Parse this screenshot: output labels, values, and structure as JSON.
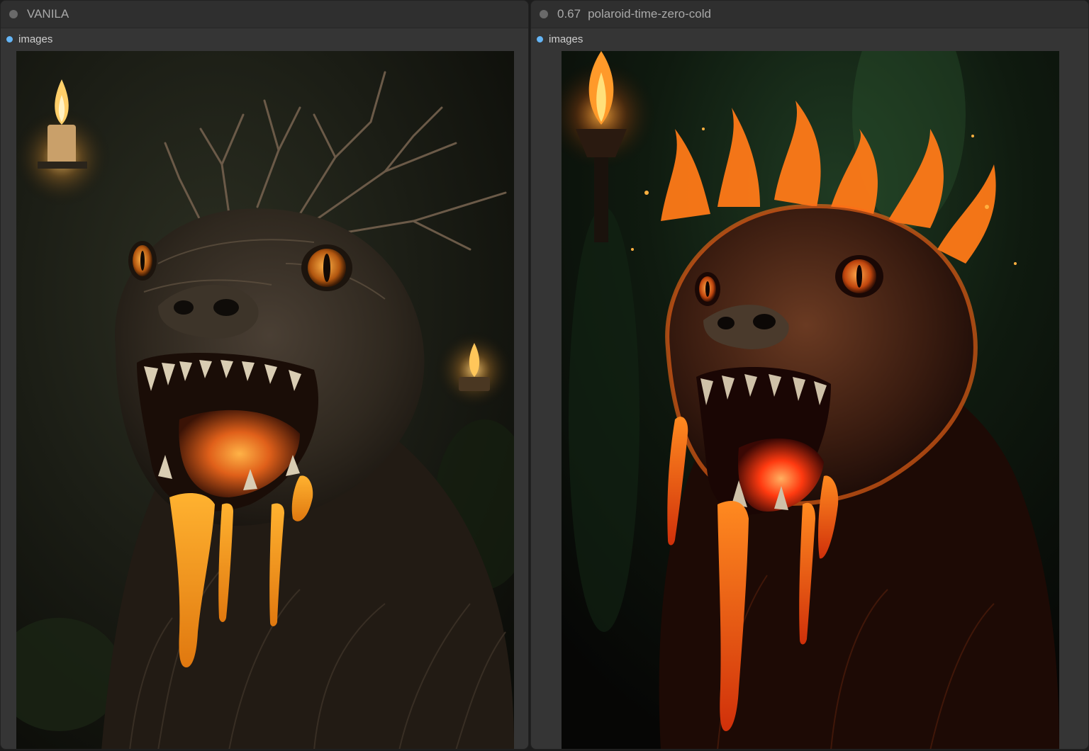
{
  "nodes": [
    {
      "title": "VANILA",
      "strength": "",
      "output_slot": "images",
      "image": {
        "subject": "dark wooden root creature with candles and dripping honey-like glow"
      }
    },
    {
      "title": "polaroid-time-zero-cold",
      "strength": "0.67",
      "output_slot": "images",
      "image": {
        "subject": "fiery lava creature with torch and flame splash crown"
      }
    }
  ],
  "colors": {
    "canvas_bg": "#1c1c1c",
    "node_bg": "#353535",
    "title_bg": "#2f2f2f",
    "title_text": "#a9a9a9",
    "slot_dot": "#64b5f6",
    "collapse_dot": "#6a6a6a"
  }
}
